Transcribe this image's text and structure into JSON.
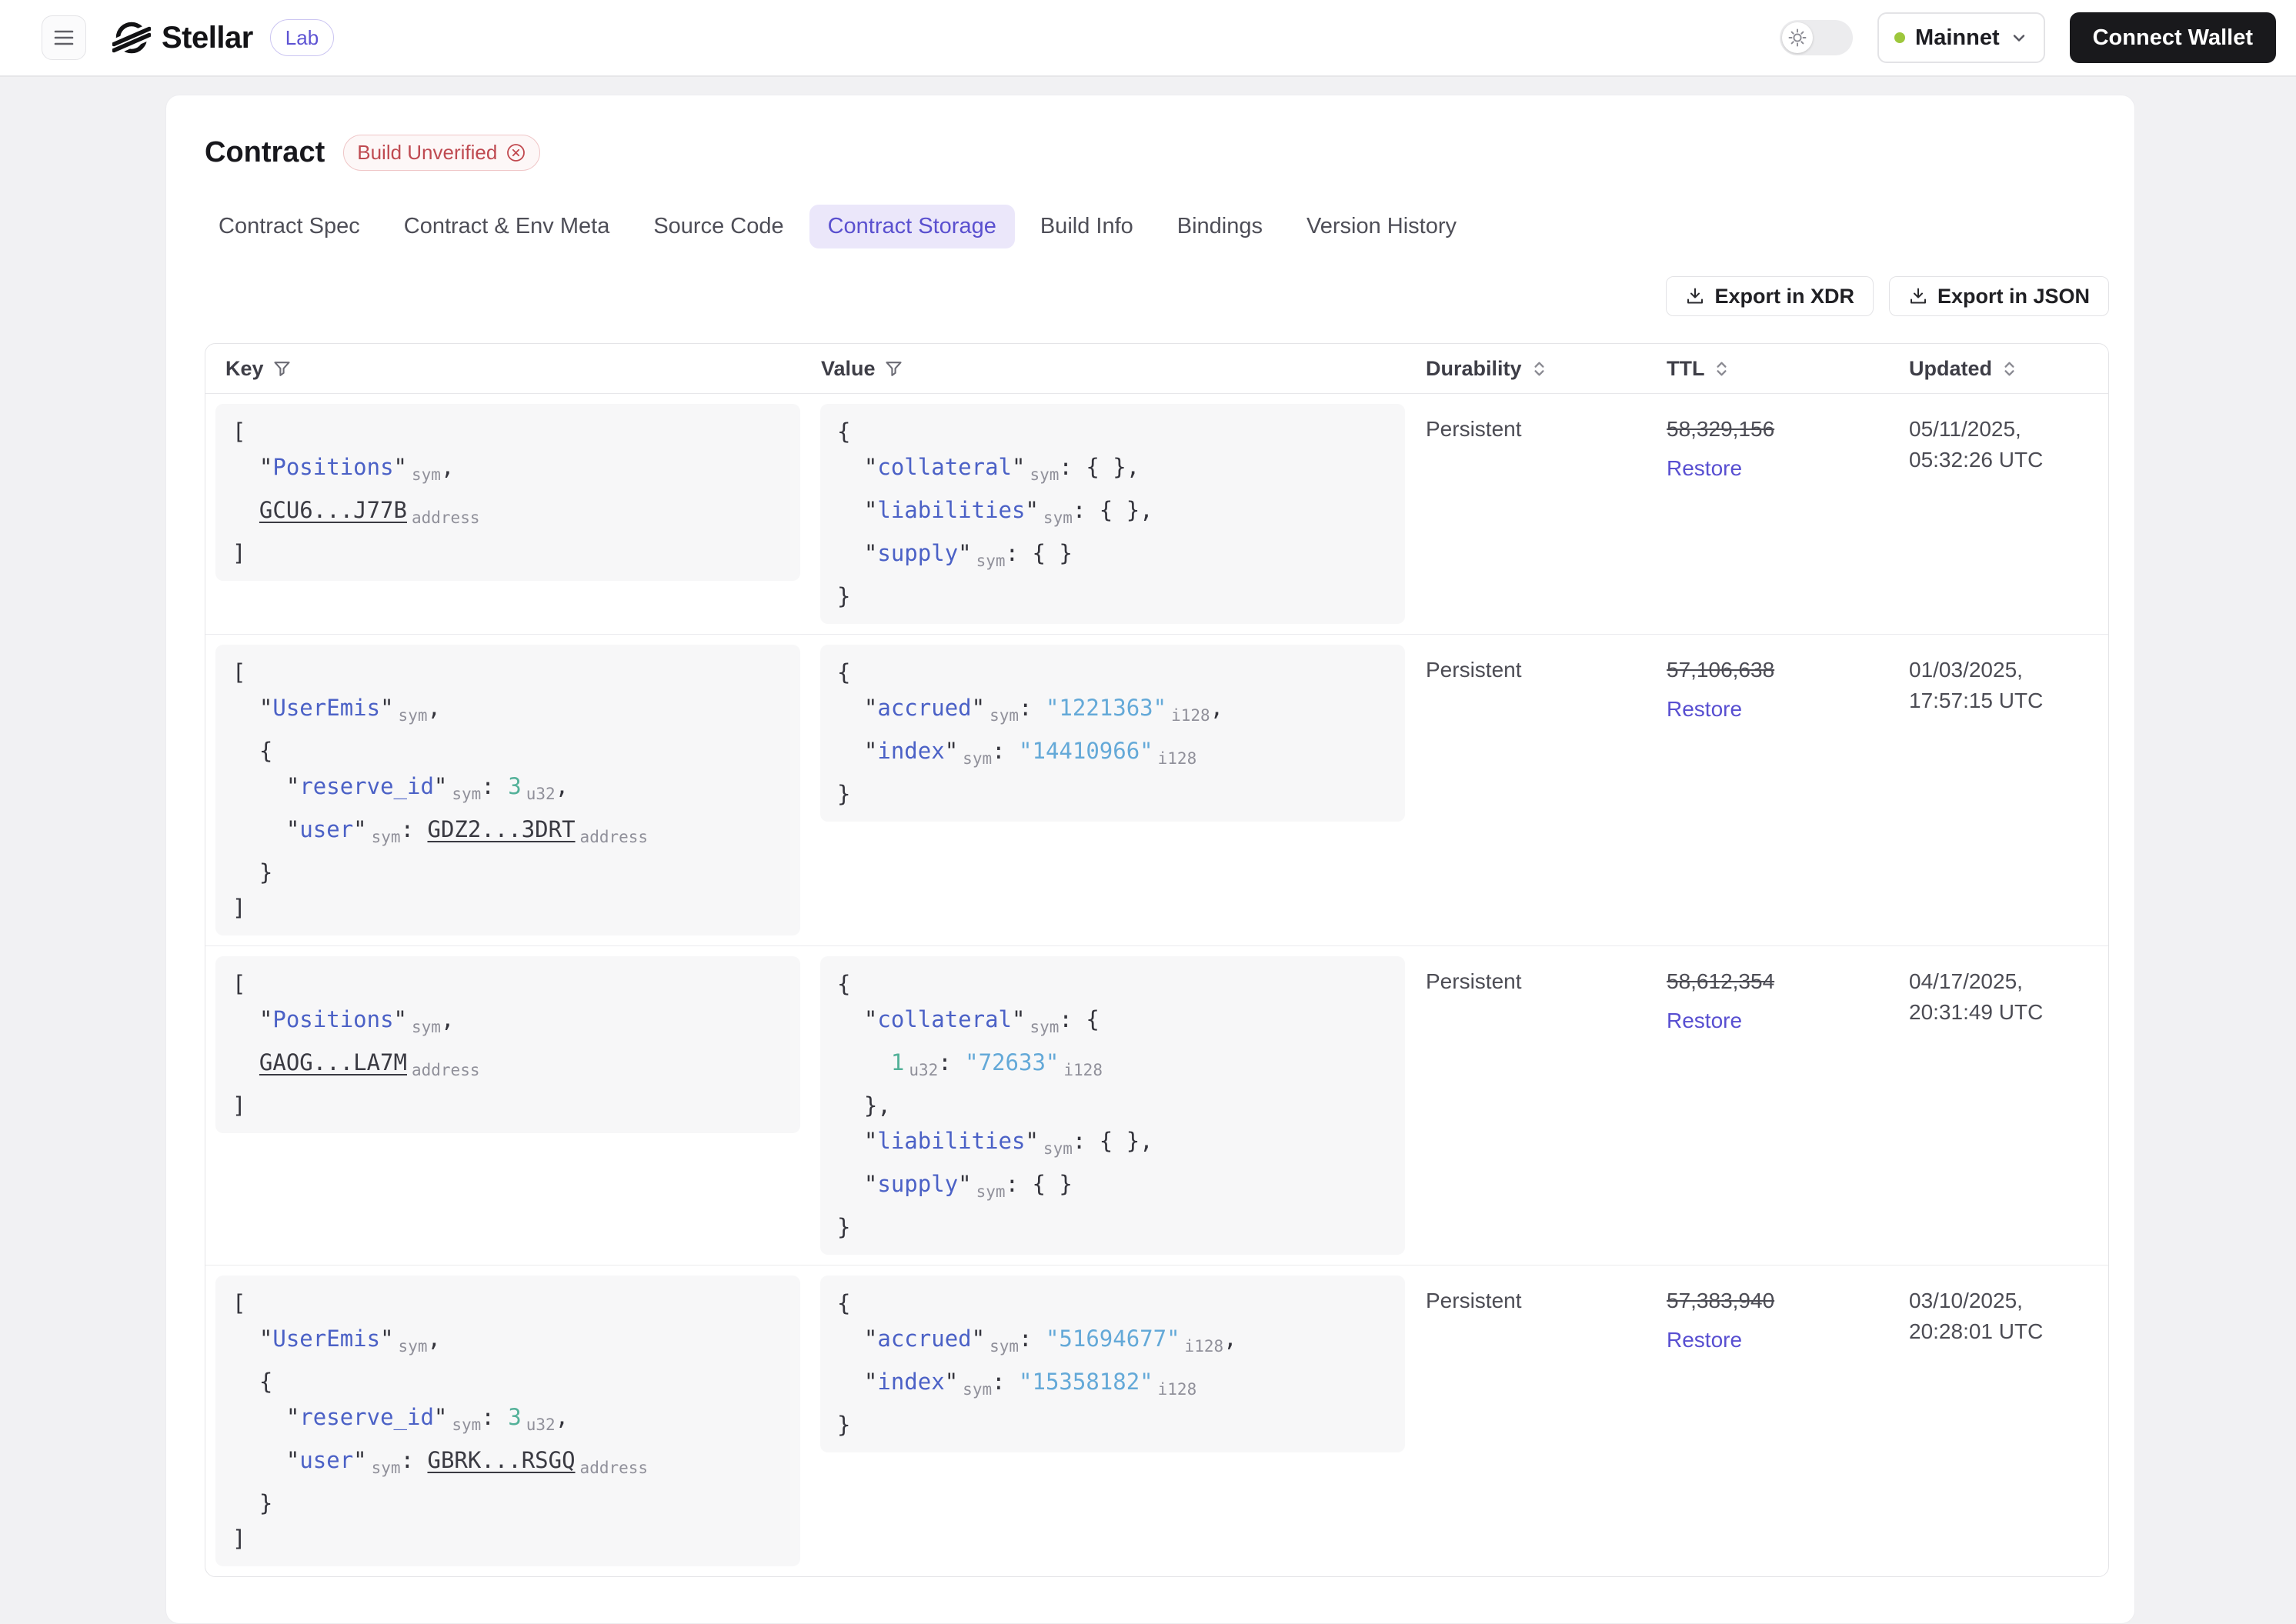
{
  "header": {
    "logo_text": "Stellar",
    "lab_badge": "Lab",
    "network": {
      "label": "Mainnet",
      "status_color": "#9dc73c"
    },
    "connect_wallet_label": "Connect Wallet"
  },
  "contract": {
    "title": "Contract",
    "verification_badge": "Build Unverified"
  },
  "tabs": [
    {
      "label": "Contract Spec",
      "active": false
    },
    {
      "label": "Contract & Env Meta",
      "active": false
    },
    {
      "label": "Source Code",
      "active": false
    },
    {
      "label": "Contract Storage",
      "active": true
    },
    {
      "label": "Build Info",
      "active": false
    },
    {
      "label": "Bindings",
      "active": false
    },
    {
      "label": "Version History",
      "active": false
    }
  ],
  "toolbar": {
    "export_xdr": "Export in XDR",
    "export_json": "Export in JSON"
  },
  "table": {
    "columns": [
      {
        "label": "Key",
        "icon": "filter",
        "class": "c-key"
      },
      {
        "label": "Value",
        "icon": "filter",
        "class": "c-val"
      },
      {
        "label": "Durability",
        "icon": "sort",
        "class": "c-dur"
      },
      {
        "label": "TTL",
        "icon": "sort",
        "class": "c-ttl"
      },
      {
        "label": "Updated",
        "icon": "sort",
        "class": "c-upd"
      }
    ],
    "rows": [
      {
        "key_lines": [
          [
            [
              "p",
              "["
            ]
          ],
          [
            [
              "p",
              "  \""
            ],
            [
              "k",
              "Positions"
            ],
            [
              "p",
              "\""
            ],
            [
              "s",
              "sym"
            ],
            [
              "p",
              ","
            ]
          ],
          [
            [
              "p",
              "  "
            ],
            [
              "a",
              "GCU6...J77B"
            ],
            [
              "s",
              "address"
            ]
          ],
          [
            [
              "p",
              "]"
            ]
          ]
        ],
        "value_lines": [
          [
            [
              "p",
              "{"
            ]
          ],
          [
            [
              "p",
              "  \""
            ],
            [
              "k",
              "collateral"
            ],
            [
              "p",
              "\""
            ],
            [
              "s",
              "sym"
            ],
            [
              "p",
              ": { },"
            ]
          ],
          [
            [
              "p",
              "  \""
            ],
            [
              "k",
              "liabilities"
            ],
            [
              "p",
              "\""
            ],
            [
              "s",
              "sym"
            ],
            [
              "p",
              ": { },"
            ]
          ],
          [
            [
              "p",
              "  \""
            ],
            [
              "k",
              "supply"
            ],
            [
              "p",
              "\""
            ],
            [
              "s",
              "sym"
            ],
            [
              "p",
              ": { }"
            ]
          ],
          [
            [
              "p",
              "}"
            ]
          ]
        ],
        "durability": "Persistent",
        "ttl": "58,329,156",
        "ttl_action": "Restore",
        "updated_date": "05/11/2025,",
        "updated_time": "05:32:26 UTC"
      },
      {
        "key_lines": [
          [
            [
              "p",
              "["
            ]
          ],
          [
            [
              "p",
              "  \""
            ],
            [
              "k",
              "UserEmis"
            ],
            [
              "p",
              "\""
            ],
            [
              "s",
              "sym"
            ],
            [
              "p",
              ","
            ]
          ],
          [
            [
              "p",
              "  {"
            ]
          ],
          [
            [
              "p",
              "    \""
            ],
            [
              "k",
              "reserve_id"
            ],
            [
              "p",
              "\""
            ],
            [
              "s",
              "sym"
            ],
            [
              "p",
              ": "
            ],
            [
              "n",
              "3"
            ],
            [
              "s",
              "u32"
            ],
            [
              "p",
              ","
            ]
          ],
          [
            [
              "p",
              "    \""
            ],
            [
              "k",
              "user"
            ],
            [
              "p",
              "\""
            ],
            [
              "s",
              "sym"
            ],
            [
              "p",
              ": "
            ],
            [
              "a",
              "GDZ2...3DRT"
            ],
            [
              "s",
              "address"
            ]
          ],
          [
            [
              "p",
              "  }"
            ]
          ],
          [
            [
              "p",
              "]"
            ]
          ]
        ],
        "value_lines": [
          [
            [
              "p",
              "{"
            ]
          ],
          [
            [
              "p",
              "  \""
            ],
            [
              "k",
              "accrued"
            ],
            [
              "p",
              "\""
            ],
            [
              "s",
              "sym"
            ],
            [
              "p",
              ": "
            ],
            [
              "v",
              "\"1221363\""
            ],
            [
              "s",
              "i128"
            ],
            [
              "p",
              ","
            ]
          ],
          [
            [
              "p",
              "  \""
            ],
            [
              "k",
              "index"
            ],
            [
              "p",
              "\""
            ],
            [
              "s",
              "sym"
            ],
            [
              "p",
              ": "
            ],
            [
              "v",
              "\"14410966\""
            ],
            [
              "s",
              "i128"
            ]
          ],
          [
            [
              "p",
              "}"
            ]
          ]
        ],
        "durability": "Persistent",
        "ttl": "57,106,638",
        "ttl_action": "Restore",
        "updated_date": "01/03/2025,",
        "updated_time": "17:57:15 UTC"
      },
      {
        "key_lines": [
          [
            [
              "p",
              "["
            ]
          ],
          [
            [
              "p",
              "  \""
            ],
            [
              "k",
              "Positions"
            ],
            [
              "p",
              "\""
            ],
            [
              "s",
              "sym"
            ],
            [
              "p",
              ","
            ]
          ],
          [
            [
              "p",
              "  "
            ],
            [
              "a",
              "GAOG...LA7M"
            ],
            [
              "s",
              "address"
            ]
          ],
          [
            [
              "p",
              "]"
            ]
          ]
        ],
        "value_lines": [
          [
            [
              "p",
              "{"
            ]
          ],
          [
            [
              "p",
              "  \""
            ],
            [
              "k",
              "collateral"
            ],
            [
              "p",
              "\""
            ],
            [
              "s",
              "sym"
            ],
            [
              "p",
              ": {"
            ]
          ],
          [
            [
              "p",
              "    "
            ],
            [
              "n",
              "1"
            ],
            [
              "s",
              "u32"
            ],
            [
              "p",
              ": "
            ],
            [
              "v",
              "\"72633\""
            ],
            [
              "s",
              "i128"
            ]
          ],
          [
            [
              "p",
              "  },"
            ]
          ],
          [
            [
              "p",
              "  \""
            ],
            [
              "k",
              "liabilities"
            ],
            [
              "p",
              "\""
            ],
            [
              "s",
              "sym"
            ],
            [
              "p",
              ": { },"
            ]
          ],
          [
            [
              "p",
              "  \""
            ],
            [
              "k",
              "supply"
            ],
            [
              "p",
              "\""
            ],
            [
              "s",
              "sym"
            ],
            [
              "p",
              ": { }"
            ]
          ],
          [
            [
              "p",
              "}"
            ]
          ]
        ],
        "durability": "Persistent",
        "ttl": "58,612,354",
        "ttl_action": "Restore",
        "updated_date": "04/17/2025,",
        "updated_time": "20:31:49 UTC"
      },
      {
        "key_lines": [
          [
            [
              "p",
              "["
            ]
          ],
          [
            [
              "p",
              "  \""
            ],
            [
              "k",
              "UserEmis"
            ],
            [
              "p",
              "\""
            ],
            [
              "s",
              "sym"
            ],
            [
              "p",
              ","
            ]
          ],
          [
            [
              "p",
              "  {"
            ]
          ],
          [
            [
              "p",
              "    \""
            ],
            [
              "k",
              "reserve_id"
            ],
            [
              "p",
              "\""
            ],
            [
              "s",
              "sym"
            ],
            [
              "p",
              ": "
            ],
            [
              "n",
              "3"
            ],
            [
              "s",
              "u32"
            ],
            [
              "p",
              ","
            ]
          ],
          [
            [
              "p",
              "    \""
            ],
            [
              "k",
              "user"
            ],
            [
              "p",
              "\""
            ],
            [
              "s",
              "sym"
            ],
            [
              "p",
              ": "
            ],
            [
              "a",
              "GBRK...RSGQ"
            ],
            [
              "s",
              "address"
            ]
          ],
          [
            [
              "p",
              "  }"
            ]
          ],
          [
            [
              "p",
              "]"
            ]
          ]
        ],
        "value_lines": [
          [
            [
              "p",
              "{"
            ]
          ],
          [
            [
              "p",
              "  \""
            ],
            [
              "k",
              "accrued"
            ],
            [
              "p",
              "\""
            ],
            [
              "s",
              "sym"
            ],
            [
              "p",
              ": "
            ],
            [
              "v",
              "\"51694677\""
            ],
            [
              "s",
              "i128"
            ],
            [
              "p",
              ","
            ]
          ],
          [
            [
              "p",
              "  \""
            ],
            [
              "k",
              "index"
            ],
            [
              "p",
              "\""
            ],
            [
              "s",
              "sym"
            ],
            [
              "p",
              ": "
            ],
            [
              "v",
              "\"15358182\""
            ],
            [
              "s",
              "i128"
            ]
          ],
          [
            [
              "p",
              "}"
            ]
          ]
        ],
        "durability": "Persistent",
        "ttl": "57,383,940",
        "ttl_action": "Restore",
        "updated_date": "03/10/2025,",
        "updated_time": "20:28:01 UTC"
      }
    ]
  },
  "colors": {
    "accent_purple": "#5a50cf",
    "badge_red": "#bf4a51",
    "code_key_blue": "#4b61c6",
    "code_string_cyan": "#64a9d8",
    "code_number_green": "#53b199",
    "network_green": "#9dc73c"
  }
}
